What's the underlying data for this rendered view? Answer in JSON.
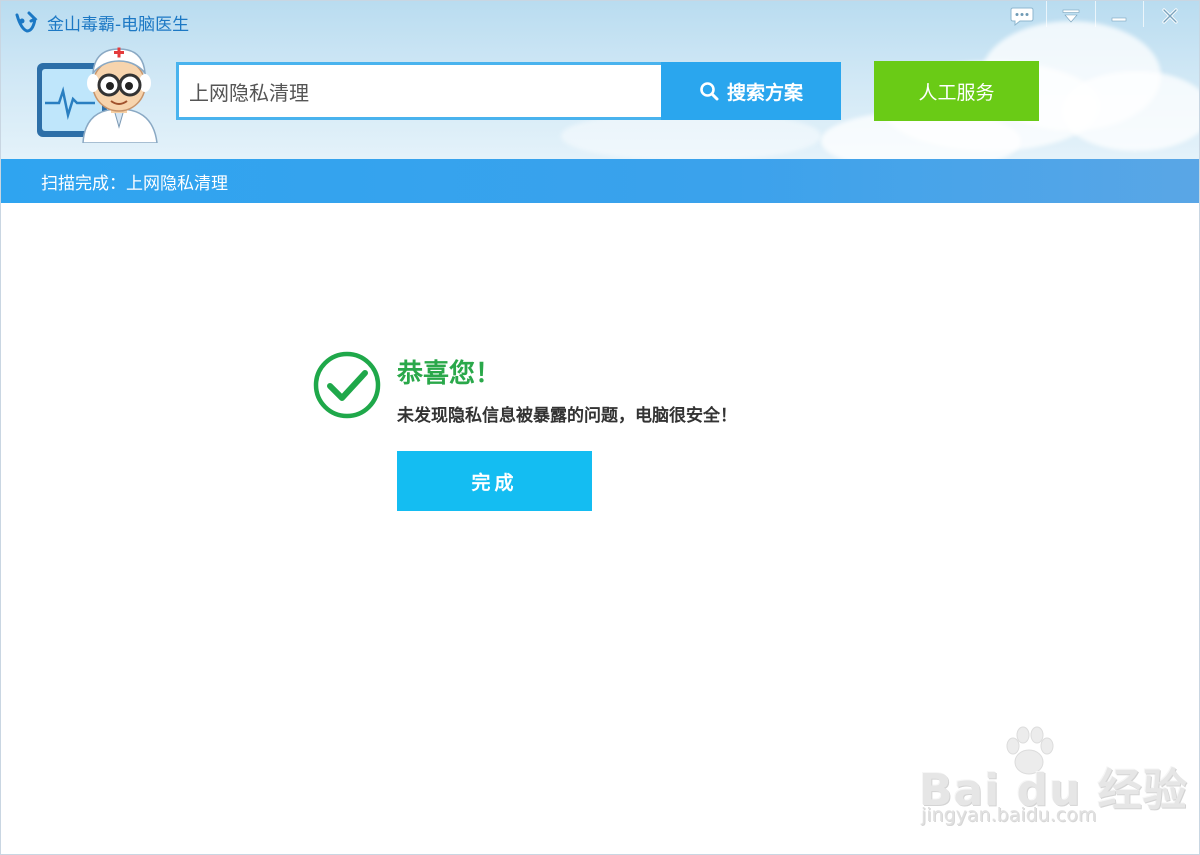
{
  "window": {
    "title": "金山毒霸-电脑医生"
  },
  "titlebar": {
    "buttons": [
      "chat",
      "menu",
      "minimize",
      "close"
    ]
  },
  "search": {
    "value": "上网隐私清理",
    "placeholder": "",
    "button_label": "搜索方案"
  },
  "service": {
    "button_label": "人工服务"
  },
  "status": {
    "text": "扫描完成：上网隐私清理"
  },
  "result": {
    "title": "恭喜您！",
    "message": "未发现隐私信息被暴露的问题，电脑很安全！",
    "done_label": "完成"
  },
  "watermark": {
    "logo_text": "Bai du 经验",
    "url": "jingyan.baidu.com"
  },
  "colors": {
    "accent_blue": "#2aa6ee",
    "service_green": "#6acb16",
    "success_green": "#2aa84a",
    "done_button": "#14bdf2",
    "status_bar": "#3aa2ec",
    "title_text": "#1c78c4"
  }
}
